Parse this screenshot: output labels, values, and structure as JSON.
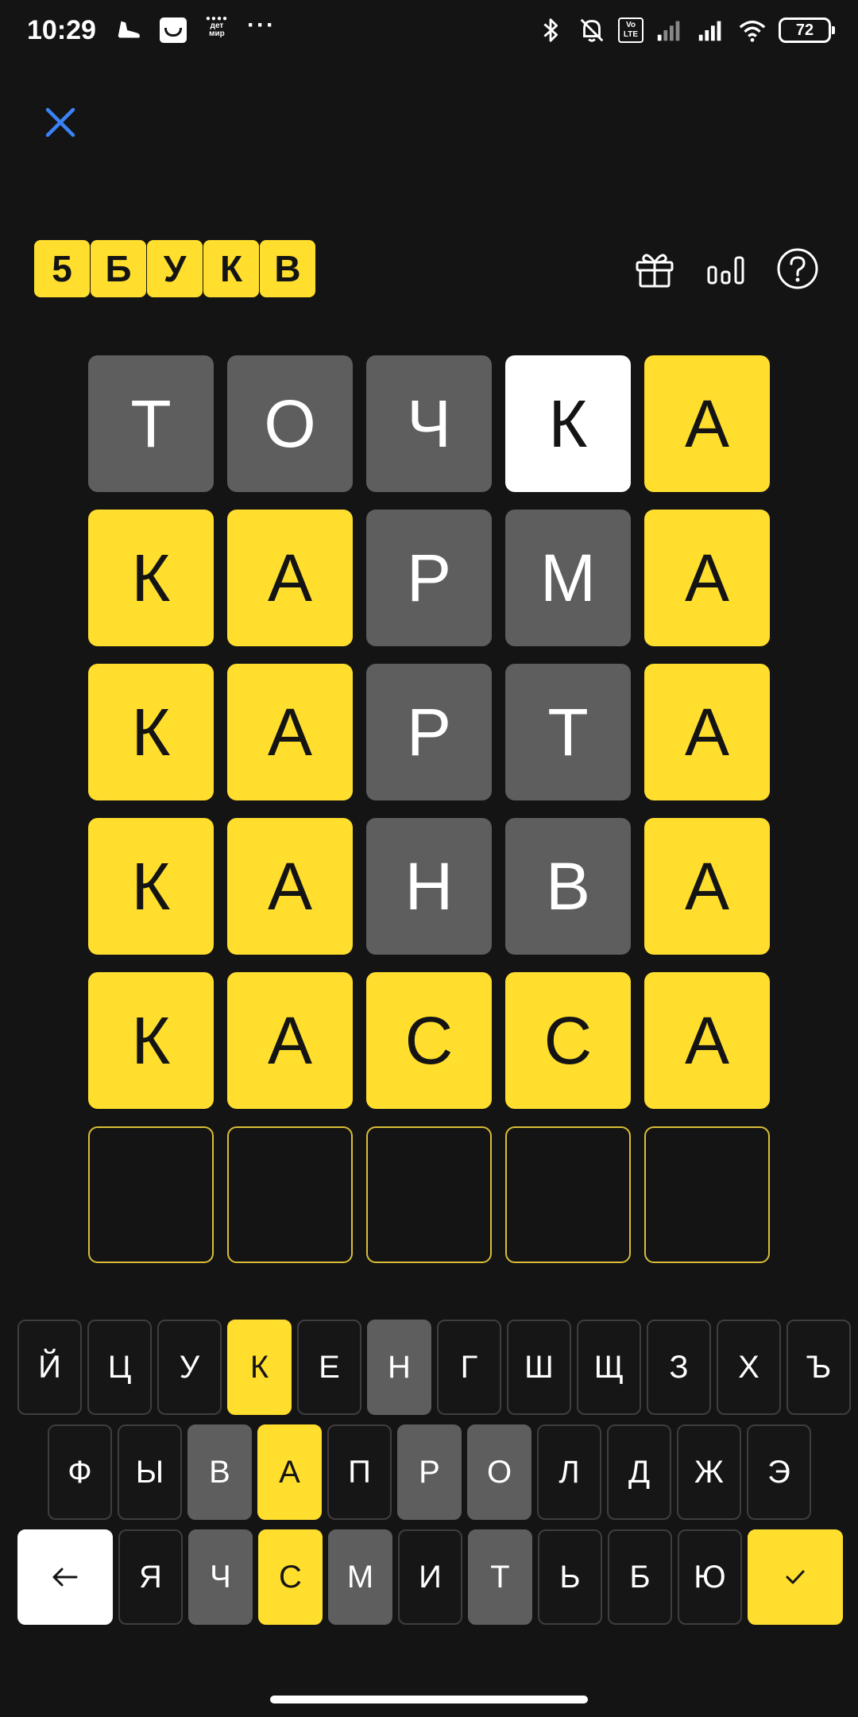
{
  "status_bar": {
    "time": "10:29",
    "battery_level": "72",
    "left_icons": [
      "running-shoe-icon",
      "shopping-bag-icon",
      "detmir-app-icon",
      "more-dots-icon"
    ],
    "right_icons": [
      "bluetooth-icon",
      "mute-bell-icon",
      "volte-icon",
      "signal-icon",
      "signal-icon",
      "wifi-icon",
      "battery-icon"
    ],
    "detmir_label_1": "дет",
    "detmir_label_2": "мир",
    "volte_label_1": "Vo",
    "volte_label_2": "LTE",
    "more_label": "···"
  },
  "header": {
    "close_icon": "close-icon",
    "logo_letters": [
      "5",
      "Б",
      "У",
      "К",
      "В"
    ],
    "actions": [
      "gift-icon",
      "stats-icon",
      "help-icon"
    ]
  },
  "colors": {
    "background": "#141414",
    "correct": "#FFDE2E",
    "absent": "#5E5E5E",
    "present": "#FFFFFF",
    "accent_close": "#3A82F7"
  },
  "board": {
    "rows": [
      [
        {
          "letter": "Т",
          "state": "gray"
        },
        {
          "letter": "О",
          "state": "gray"
        },
        {
          "letter": "Ч",
          "state": "gray"
        },
        {
          "letter": "К",
          "state": "white"
        },
        {
          "letter": "А",
          "state": "yellow"
        }
      ],
      [
        {
          "letter": "К",
          "state": "yellow"
        },
        {
          "letter": "А",
          "state": "yellow"
        },
        {
          "letter": "Р",
          "state": "gray"
        },
        {
          "letter": "М",
          "state": "gray"
        },
        {
          "letter": "А",
          "state": "yellow"
        }
      ],
      [
        {
          "letter": "К",
          "state": "yellow"
        },
        {
          "letter": "А",
          "state": "yellow"
        },
        {
          "letter": "Р",
          "state": "gray"
        },
        {
          "letter": "Т",
          "state": "gray"
        },
        {
          "letter": "А",
          "state": "yellow"
        }
      ],
      [
        {
          "letter": "К",
          "state": "yellow"
        },
        {
          "letter": "А",
          "state": "yellow"
        },
        {
          "letter": "Н",
          "state": "gray"
        },
        {
          "letter": "В",
          "state": "gray"
        },
        {
          "letter": "А",
          "state": "yellow"
        }
      ],
      [
        {
          "letter": "К",
          "state": "yellow"
        },
        {
          "letter": "А",
          "state": "yellow"
        },
        {
          "letter": "С",
          "state": "yellow"
        },
        {
          "letter": "С",
          "state": "yellow"
        },
        {
          "letter": "А",
          "state": "yellow"
        }
      ],
      [
        {
          "letter": "",
          "state": "empty"
        },
        {
          "letter": "",
          "state": "empty"
        },
        {
          "letter": "",
          "state": "empty"
        },
        {
          "letter": "",
          "state": "empty"
        },
        {
          "letter": "",
          "state": "empty"
        }
      ]
    ]
  },
  "keyboard": {
    "rows": [
      [
        {
          "key": "Й",
          "state": "default"
        },
        {
          "key": "Ц",
          "state": "default"
        },
        {
          "key": "У",
          "state": "default"
        },
        {
          "key": "К",
          "state": "yellow"
        },
        {
          "key": "Е",
          "state": "default"
        },
        {
          "key": "Н",
          "state": "gray"
        },
        {
          "key": "Г",
          "state": "default"
        },
        {
          "key": "Ш",
          "state": "default"
        },
        {
          "key": "Щ",
          "state": "default"
        },
        {
          "key": "З",
          "state": "default"
        },
        {
          "key": "Х",
          "state": "default"
        },
        {
          "key": "Ъ",
          "state": "default"
        }
      ],
      [
        {
          "key": "Ф",
          "state": "default"
        },
        {
          "key": "Ы",
          "state": "default"
        },
        {
          "key": "В",
          "state": "gray"
        },
        {
          "key": "А",
          "state": "yellow"
        },
        {
          "key": "П",
          "state": "default"
        },
        {
          "key": "Р",
          "state": "gray"
        },
        {
          "key": "О",
          "state": "gray"
        },
        {
          "key": "Л",
          "state": "default"
        },
        {
          "key": "Д",
          "state": "default"
        },
        {
          "key": "Ж",
          "state": "default"
        },
        {
          "key": "Э",
          "state": "default"
        }
      ],
      [
        {
          "key": "Я",
          "state": "default"
        },
        {
          "key": "Ч",
          "state": "gray"
        },
        {
          "key": "С",
          "state": "yellow"
        },
        {
          "key": "М",
          "state": "gray"
        },
        {
          "key": "И",
          "state": "default"
        },
        {
          "key": "Т",
          "state": "gray"
        },
        {
          "key": "Ь",
          "state": "default"
        },
        {
          "key": "Б",
          "state": "default"
        },
        {
          "key": "Ю",
          "state": "default"
        }
      ]
    ],
    "backspace_icon": "backspace-arrow-icon",
    "submit_icon": "checkmark-icon"
  }
}
